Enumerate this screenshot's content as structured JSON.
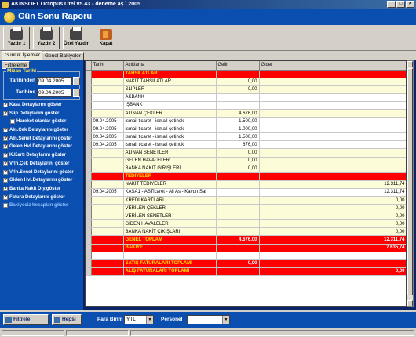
{
  "window": {
    "title": "AKINSOFT Octopus Otel v5.43  -  deneme aş \\ 2005"
  },
  "header": {
    "title": "Gün Sonu Raporu"
  },
  "toolbar": {
    "print1": "Yazdır 1",
    "print2": "Yazdır 2",
    "custom_print": "Özel Yazdır",
    "close": "Kapat"
  },
  "tabs": [
    "Günlük İşlemler",
    "Genel Bakiyeler"
  ],
  "filter": {
    "tab_label": "Filtreleme",
    "date_group": "Mizan Tarihi",
    "from_label": "Tarihinden",
    "from_value": "09.04.2005",
    "to_label": "Tarihine",
    "to_value": "09.04.2005",
    "options": [
      {
        "label": "Kasa Detaylarını göster",
        "checked": true
      },
      {
        "label": "Slip Detaylarını göster",
        "checked": true
      },
      {
        "label": "Hareket olanlar göster",
        "checked": false,
        "indent": true
      },
      {
        "label": "Aln.Çek Detaylarını göster",
        "checked": true
      },
      {
        "label": "Aln.Senet Detaylarını göster",
        "checked": true
      },
      {
        "label": "Gelen Hvl.Detaylarını göster",
        "checked": true
      },
      {
        "label": "K.Kartı Detaylarını göster",
        "checked": true
      },
      {
        "label": "Vrln.Çek Detaylarını göster",
        "checked": true
      },
      {
        "label": "Vrln.Senet Detaylarını göster",
        "checked": true
      },
      {
        "label": "Giden Hvl.Detaylarını göster",
        "checked": true
      },
      {
        "label": "Banka Nakit Dty.göster",
        "checked": true
      },
      {
        "label": "Fatura Detaylarını göster",
        "checked": true
      },
      {
        "label": "Bakiyesiz hesapları göster",
        "checked": false,
        "faint": true
      }
    ]
  },
  "grid": {
    "columns": [
      "Tarihi",
      "Açıklama",
      "Gelir",
      "Gider"
    ],
    "rows": [
      {
        "style": "red",
        "date": "",
        "desc": "TAHSİLATLAR",
        "in": "",
        "out": ""
      },
      {
        "style": "alt",
        "date": "",
        "desc": "NAKİT TAHSİLATLAR",
        "in": "0,00",
        "out": ""
      },
      {
        "style": "alt",
        "date": "",
        "desc": "SLİPLER",
        "in": "0,00",
        "out": ""
      },
      {
        "style": "plain",
        "date": "",
        "desc": "AKBANK",
        "in": "",
        "out": ""
      },
      {
        "style": "plain",
        "date": "",
        "desc": "İŞBANK",
        "in": "",
        "out": ""
      },
      {
        "style": "alt",
        "date": "",
        "desc": "ALINAN ÇEKLER",
        "in": "4.676,00",
        "out": ""
      },
      {
        "style": "plain",
        "date": "09.04.2005",
        "desc": "ismail ticaret - ismail  çetinok",
        "in": "1.500,00",
        "out": ""
      },
      {
        "style": "plain",
        "date": "09.04.2005",
        "desc": "ismail ticaret - ismail  çetinok",
        "in": "1.000,00",
        "out": ""
      },
      {
        "style": "plain",
        "date": "09.04.2005",
        "desc": "ismail ticaret - ismail  çetinok",
        "in": "1.500,00",
        "out": ""
      },
      {
        "style": "plain",
        "date": "09.04.2005",
        "desc": "ismail ticaret - ismail  çetinok",
        "in": "676,00",
        "out": ""
      },
      {
        "style": "alt",
        "date": "",
        "desc": "ALINAN SENETLER",
        "in": "0,00",
        "out": ""
      },
      {
        "style": "alt",
        "date": "",
        "desc": "GELEN HAVALELER",
        "in": "0,00",
        "out": ""
      },
      {
        "style": "alt",
        "date": "",
        "desc": "BANKA NAKİT GİRİŞLERİ",
        "in": "0,00",
        "out": ""
      },
      {
        "style": "red",
        "date": "",
        "desc": "TEDİYELER",
        "in": "",
        "out": ""
      },
      {
        "style": "alt",
        "date": "",
        "desc": "NAKİT TEDİYELER",
        "in": "",
        "out": "12.311,74"
      },
      {
        "style": "plain",
        "date": "09.04.2005",
        "desc": "KASA1 - ASTicaret - Ali As - Kavun,Sal",
        "in": "",
        "out": "12.311,74"
      },
      {
        "style": "alt",
        "date": "",
        "desc": "KREDİ KARTLARI",
        "in": "",
        "out": "0,00"
      },
      {
        "style": "alt",
        "date": "",
        "desc": "VERİLEN ÇEKLER",
        "in": "",
        "out": "0,00"
      },
      {
        "style": "alt",
        "date": "",
        "desc": "VERİLEN SENETLER",
        "in": "",
        "out": "0,00"
      },
      {
        "style": "alt",
        "date": "",
        "desc": "GİDEN HAVALELER",
        "in": "",
        "out": "0,00"
      },
      {
        "style": "alt",
        "date": "",
        "desc": "BANKA NAKİT ÇIKIŞLARI",
        "in": "",
        "out": "0,00"
      },
      {
        "style": "red",
        "date": "",
        "desc": "GENEL TOPLAM",
        "in": "4.676,00",
        "out": "12.311,74"
      },
      {
        "style": "red",
        "date": "",
        "desc": "BAKİYE",
        "in": "",
        "out": "7.635,74"
      },
      {
        "style": "empty",
        "date": "",
        "desc": "",
        "in": "",
        "out": ""
      },
      {
        "style": "red",
        "date": "",
        "desc": "SATIŞ FATURALARI TOPLAMI",
        "in": "0,00",
        "out": ""
      },
      {
        "style": "red",
        "date": "",
        "desc": "ALIŞ FATURALARI TOPLAMI",
        "in": "",
        "out": "0,00"
      }
    ]
  },
  "bottom": {
    "filter_button": "Filtrele",
    "all_button": "Hepsi",
    "currency_label": "Para Birim",
    "currency_value": "YTL",
    "staff_label": "Personel",
    "staff_value": ""
  }
}
